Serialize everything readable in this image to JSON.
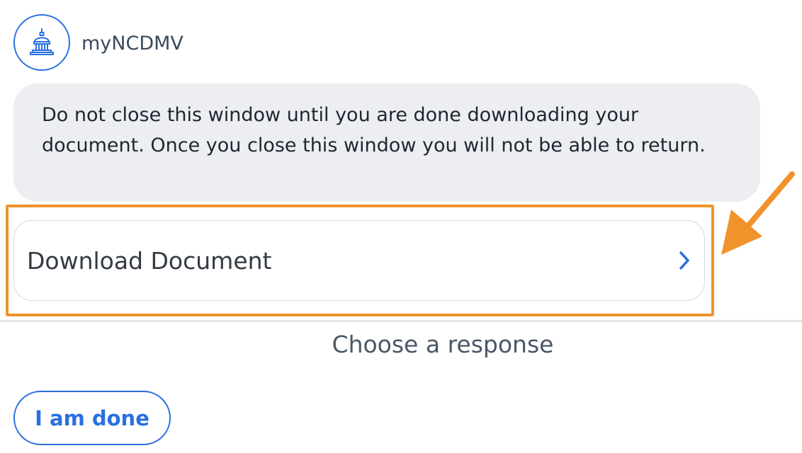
{
  "header": {
    "sender_name": "myNCDMV",
    "avatar_icon": "capitol-building-icon"
  },
  "message": {
    "text": "Do not close this window until you are done downloading your document. Once you close this window you will not be able to return."
  },
  "download_card": {
    "label": "Download Document",
    "icon": "chevron-right-icon"
  },
  "annotation": {
    "highlight_color": "#f0932b",
    "arrow_icon": "pointer-arrow-icon"
  },
  "responses": {
    "prompt": "Choose a response",
    "options": [
      {
        "label": "I am done"
      }
    ]
  },
  "colors": {
    "accent": "#2a6fe0",
    "bubble_bg": "#edeef2",
    "annotation": "#f0932b"
  }
}
